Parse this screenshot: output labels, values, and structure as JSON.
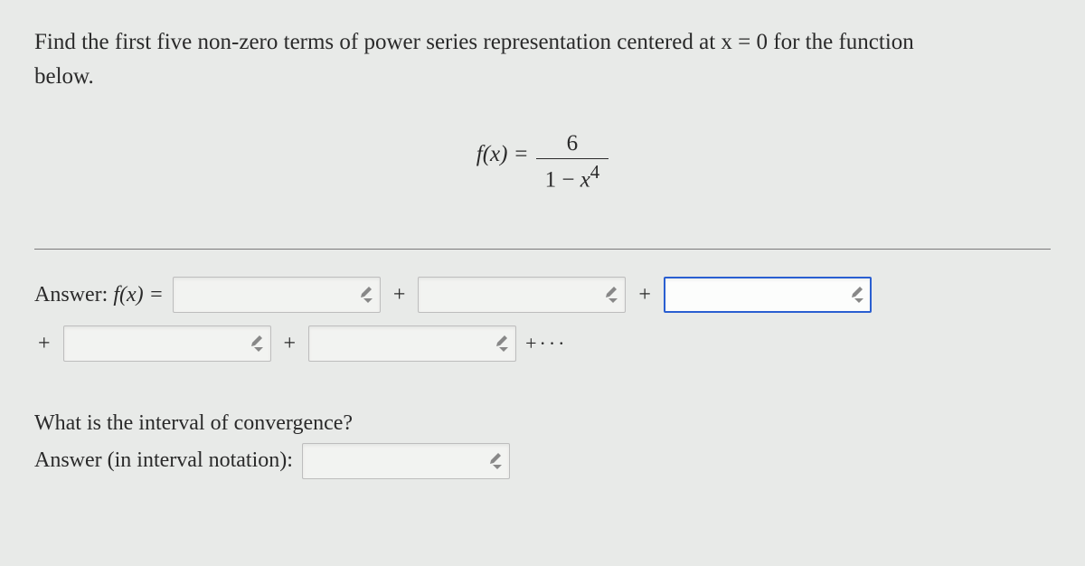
{
  "prompt": {
    "line1": "Find the first five non-zero terms of power series representation centered at x = 0 for the function",
    "line2": "below."
  },
  "equation": {
    "lhs": "f(x) =",
    "numerator": "6",
    "denominator_prefix": "1 − ",
    "denominator_var": "x",
    "denominator_exp": "4"
  },
  "answer": {
    "label_prefix": "Answer: ",
    "label_fn": "f(x) =",
    "plus": "+",
    "ellipsis": "+···",
    "terms": [
      "",
      "",
      "",
      "",
      ""
    ]
  },
  "ioc": {
    "question": "What is the interval of convergence?",
    "label": "Answer (in interval notation):",
    "value": ""
  }
}
